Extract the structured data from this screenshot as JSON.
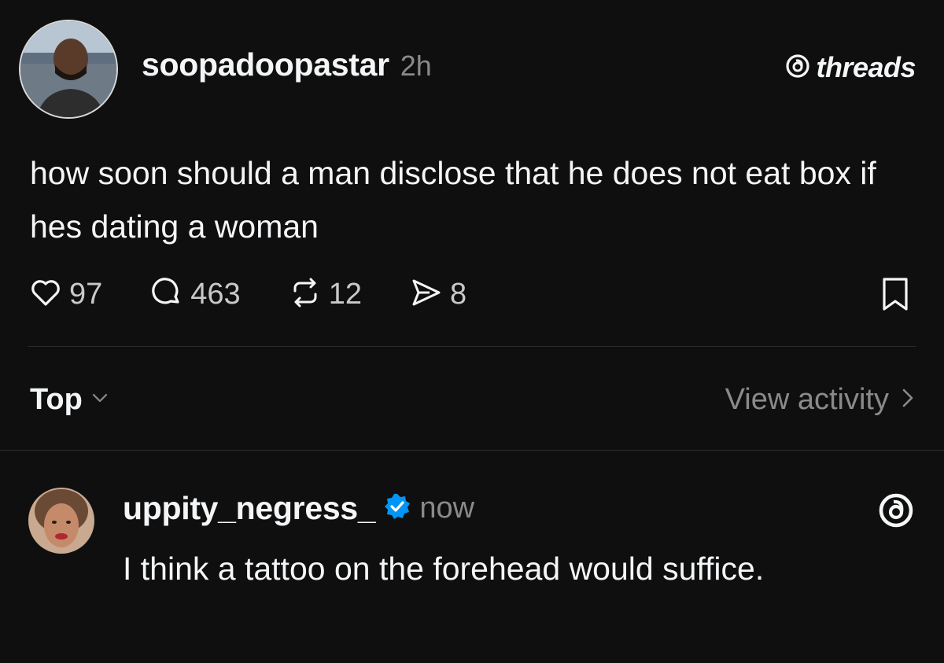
{
  "post": {
    "username": "soopadoopastar",
    "timestamp": "2h",
    "body": "how soon should a man disclose that he does not eat box if hes dating  a woman",
    "brand": "threads",
    "stats": {
      "likes": "97",
      "comments": "463",
      "reposts": "12",
      "shares": "8"
    }
  },
  "icons": {
    "like": "heart-icon",
    "comment": "speech-bubble-icon",
    "repost": "repost-icon",
    "share": "send-icon",
    "bookmark": "bookmark-icon",
    "brand": "threads-logo-icon",
    "verified": "verified-badge-icon"
  },
  "sort": {
    "label": "Top"
  },
  "activity": {
    "label": "View activity"
  },
  "reply": {
    "username": "uppity_negress_",
    "timestamp": "now",
    "body": "I think a tattoo on the forehead would suffice."
  },
  "colors": {
    "background": "#0f0f0f",
    "text": "#f3f5f7",
    "muted": "#8a8a8a",
    "verified": "#0095f6"
  }
}
